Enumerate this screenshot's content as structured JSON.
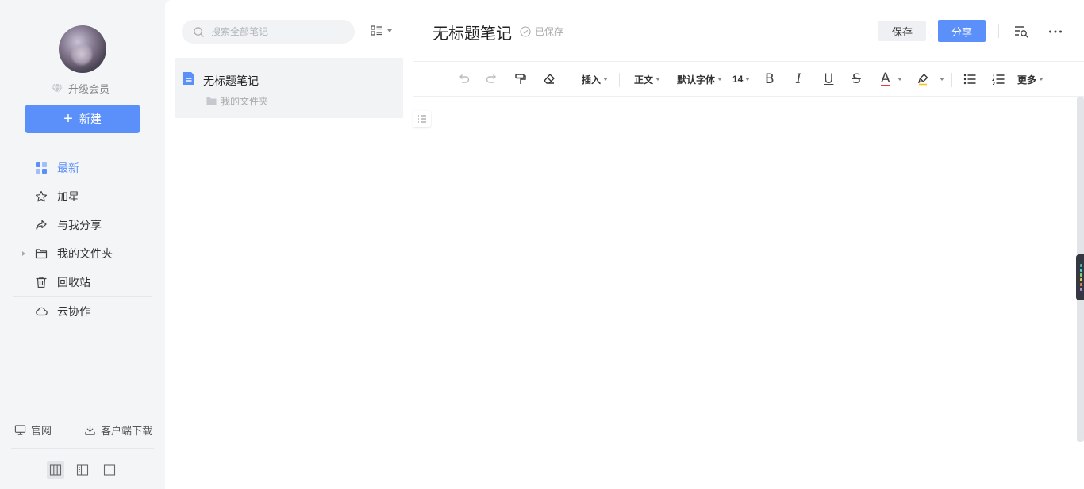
{
  "sidebar": {
    "vip_label": "升级会员",
    "new_button": "新建",
    "nav": [
      {
        "label": "最新",
        "icon": "grid-icon",
        "active": true
      },
      {
        "label": "加星",
        "icon": "star-icon"
      },
      {
        "label": "与我分享",
        "icon": "share-arrow-icon"
      },
      {
        "label": "我的文件夹",
        "icon": "folder-icon",
        "expandable": true
      },
      {
        "label": "回收站",
        "icon": "trash-icon"
      },
      {
        "label": "云协作",
        "icon": "cloud-icon"
      }
    ],
    "footer": {
      "website": "官网",
      "download": "客户端下载"
    },
    "layout_modes": [
      "three-column-layout",
      "two-column-layout",
      "single-column-layout"
    ]
  },
  "list": {
    "search_placeholder": "搜索全部笔记",
    "notes": [
      {
        "title": "无标题笔记",
        "folder": "我的文件夹"
      }
    ]
  },
  "editor": {
    "title": "无标题笔记",
    "saved_status": "已保存",
    "save_button": "保存",
    "share_button": "分享",
    "toolbar": {
      "insert": "插入",
      "paragraph_style": "正文",
      "font": "默认字体",
      "font_size": "14",
      "bold": "B",
      "italic": "I",
      "underline": "U",
      "strike": "S",
      "font_color": "A",
      "more": "更多"
    }
  },
  "colors": {
    "accent": "#5b8ff9",
    "sidebar_bg": "#f4f5f7",
    "font_color_underline": "#e33c3c"
  }
}
